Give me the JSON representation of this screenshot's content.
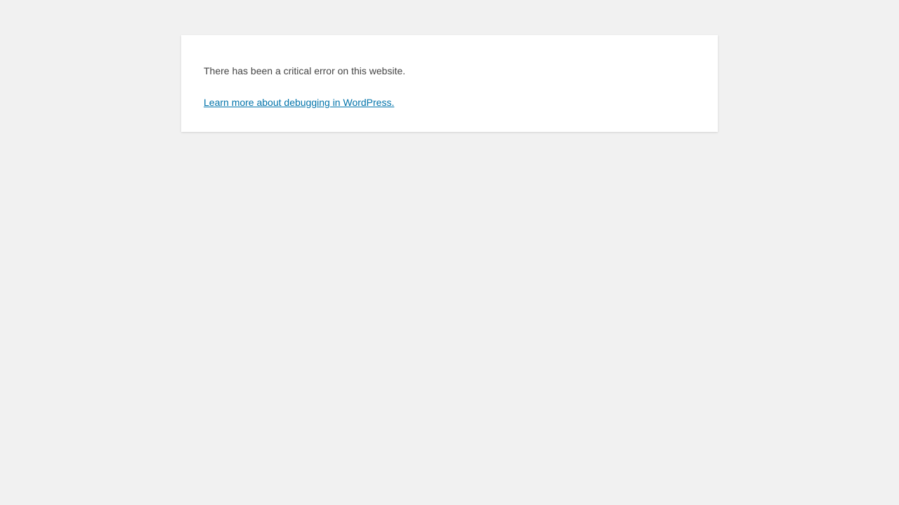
{
  "error": {
    "message": "There has been a critical error on this website.",
    "link_label": "Learn more about debugging in WordPress."
  },
  "colors": {
    "background": "#f1f1f1",
    "panel": "#ffffff",
    "text": "#444444",
    "link": "#0073aa"
  }
}
